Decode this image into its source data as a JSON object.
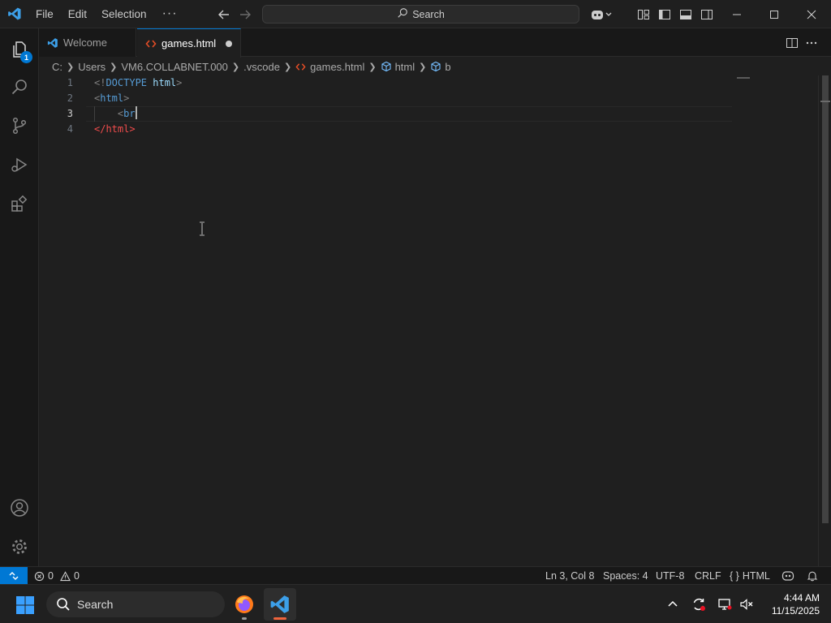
{
  "menu": {
    "file": "File",
    "edit": "Edit",
    "selection": "Selection",
    "more": "···"
  },
  "command_center": {
    "label": "Search"
  },
  "tabs": [
    {
      "label": "Welcome",
      "active": false
    },
    {
      "label": "games.html",
      "active": true,
      "dirty": true
    }
  ],
  "activity": {
    "explorer_badge": "1"
  },
  "breadcrumb": [
    "C:",
    "Users",
    "VM6.COLLABNET.000",
    ".vscode",
    "games.html",
    "html",
    "b"
  ],
  "editor": {
    "lines": [
      {
        "num": "1",
        "parts": [
          [
            "t-punc",
            "<!"
          ],
          [
            "t-kw",
            "DOCTYPE"
          ],
          [
            "",
            ""
          ],
          [
            "t-attr",
            " html"
          ],
          [
            "t-punc",
            ">"
          ]
        ]
      },
      {
        "num": "2",
        "parts": [
          [
            "t-punc",
            "<"
          ],
          [
            "t-tag",
            "html"
          ],
          [
            "t-punc",
            ">"
          ]
        ]
      },
      {
        "num": "3",
        "parts": [
          [
            "",
            "    "
          ],
          [
            "t-punc",
            "<"
          ],
          [
            "t-tag",
            "br"
          ]
        ]
      },
      {
        "num": "4",
        "parts": [
          [
            "t-err",
            "</"
          ],
          [
            "t-err",
            "html"
          ],
          [
            "t-err",
            ">"
          ]
        ]
      }
    ]
  },
  "status": {
    "errors": "0",
    "warnings": "0",
    "position": "Ln 3, Col 8",
    "spaces": "Spaces: 4",
    "encoding": "UTF-8",
    "eol": "CRLF",
    "language": "HTML",
    "language_icon": "{ }"
  },
  "taskbar": {
    "search_label": "Search"
  },
  "clock": {
    "time": "4:44 AM",
    "date": "11/15/2025"
  },
  "colors": {
    "accent": "#0078d4",
    "editor_bg": "#1f1f1f",
    "sidebar_bg": "#181818"
  }
}
